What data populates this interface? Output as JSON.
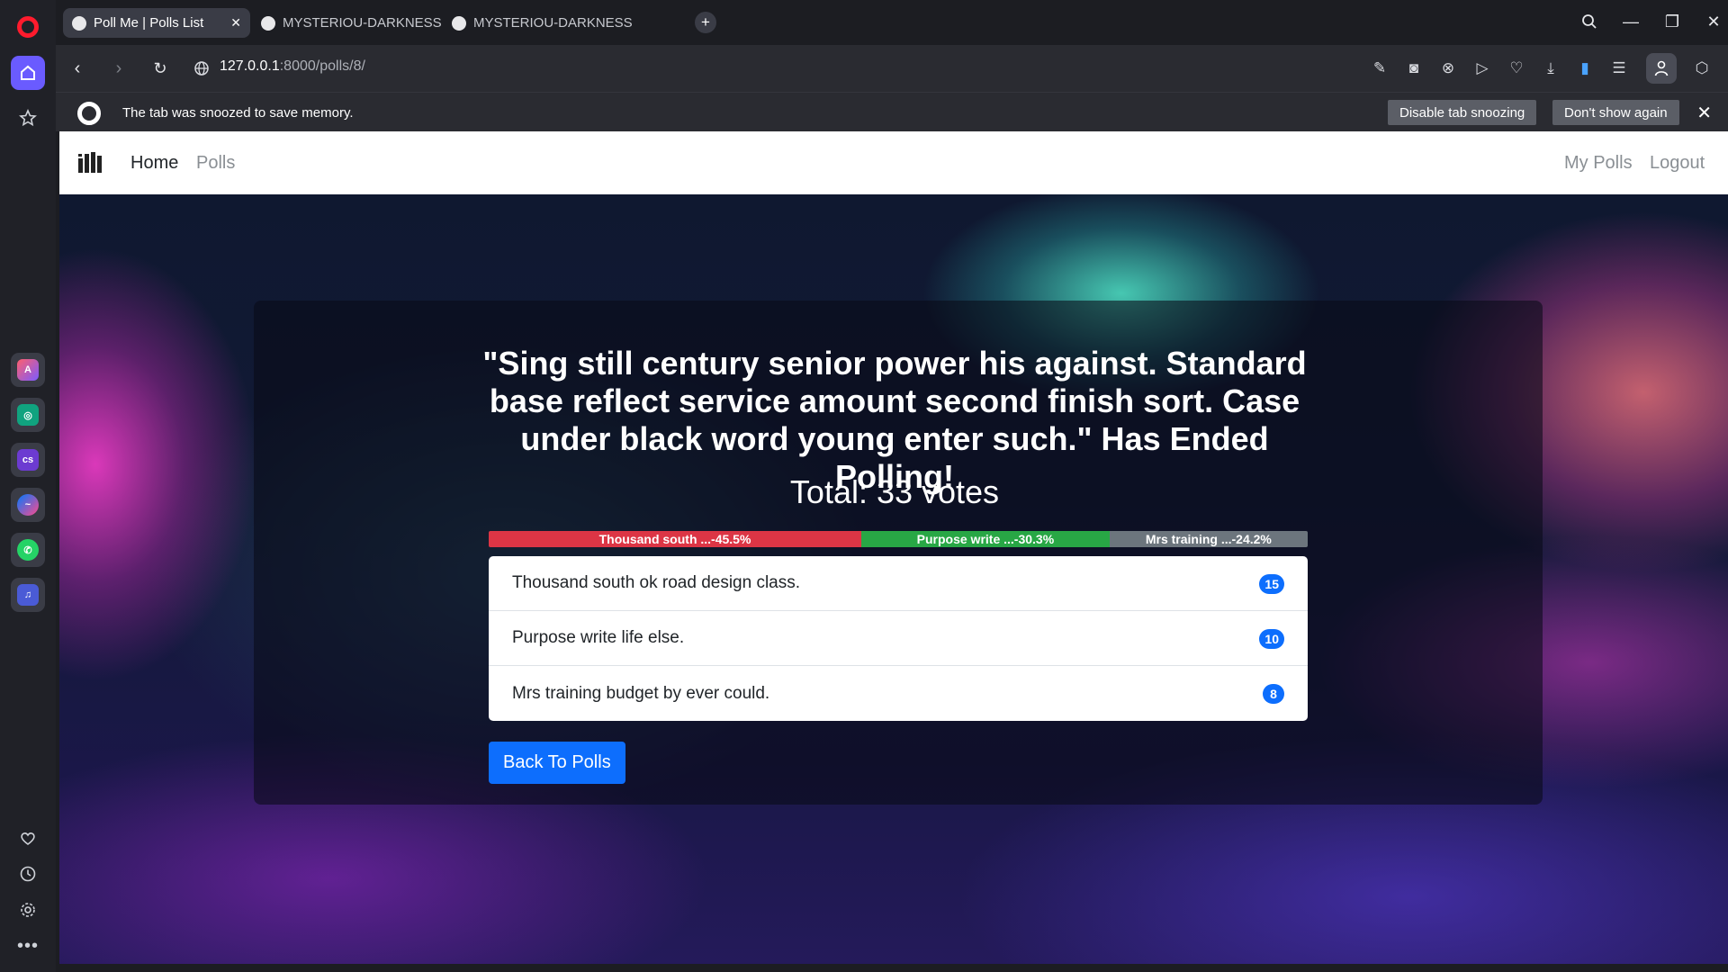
{
  "browser": {
    "tabs": [
      {
        "title": "Poll Me | Polls List",
        "active": true
      },
      {
        "title": "MYSTERIOU-DARKNESS/V",
        "active": false
      },
      {
        "title": "MYSTERIOU-DARKNESS/V",
        "active": false
      }
    ],
    "url_host": "127.0.0.1",
    "url_path": ":8000/polls/8/",
    "snooze": {
      "message": "The tab was snoozed to save memory.",
      "disable_label": "Disable tab snoozing",
      "dont_show_label": "Don't show again"
    }
  },
  "navbar": {
    "home": "Home",
    "polls": "Polls",
    "my_polls": "My Polls",
    "logout": "Logout"
  },
  "poll": {
    "question": "\"Sing still century senior power his against. Standard base reflect service amount second finish sort. Case under black word young enter such.\" Has Ended Polling!",
    "total": "Total: 33 votes",
    "bar": [
      {
        "label": "Thousand south ...-45.5%",
        "percent": 45.5,
        "color": "#dc3545"
      },
      {
        "label": "Purpose write ...-30.3%",
        "percent": 30.3,
        "color": "#28a745"
      },
      {
        "label": "Mrs training ...-24.2%",
        "percent": 24.2,
        "color": "#6c757d"
      }
    ],
    "choices": [
      {
        "text": "Thousand south ok road design class.",
        "votes": "15"
      },
      {
        "text": "Purpose write life else.",
        "votes": "10"
      },
      {
        "text": "Mrs training budget by ever could.",
        "votes": "8"
      }
    ],
    "back_label": "Back To Polls"
  },
  "colors": {
    "primary": "#0d6efd",
    "danger": "#dc3545",
    "success": "#28a745",
    "secondary": "#6c757d",
    "opera_accent": "#6a5bff"
  }
}
